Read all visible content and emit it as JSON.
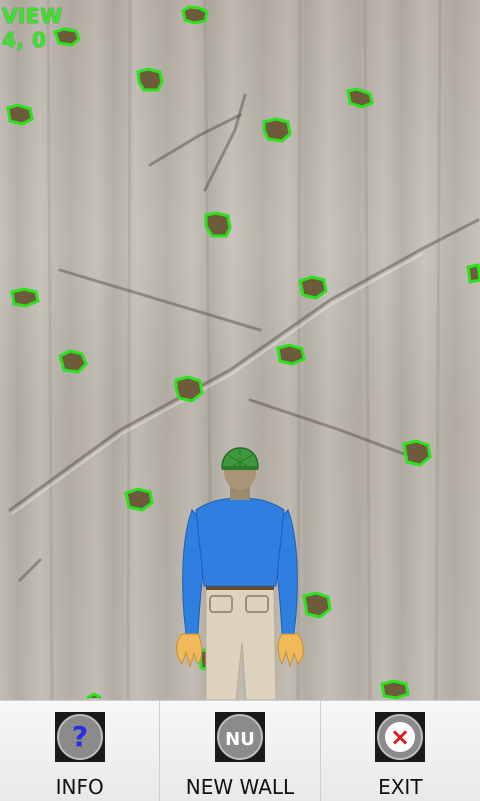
{
  "hud": {
    "view_label": "VIEW",
    "view_coords": "4, 0"
  },
  "menu": [
    {
      "label": "INFO",
      "icon": "info-icon",
      "icon_text": "?"
    },
    {
      "label": "NEW WALL",
      "icon": "new-wall-icon",
      "icon_text": "NU"
    },
    {
      "label": "EXIT",
      "icon": "exit-icon",
      "icon_text": "×"
    }
  ],
  "colors": {
    "hud_text": "#39e52c",
    "hold_outline": "#2ee11f",
    "hold_fill": "#6e5b3b",
    "shirt": "#2f7fe0",
    "helmet": "#3c9a3e",
    "exit_mark": "#e01818"
  }
}
